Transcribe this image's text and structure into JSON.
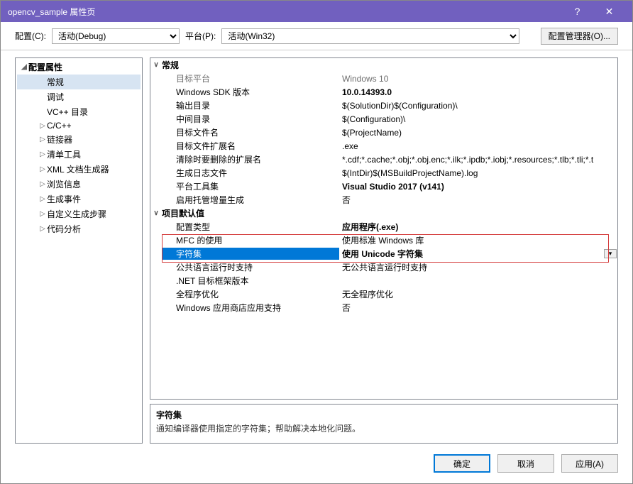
{
  "window": {
    "title": "opencv_sample 属性页"
  },
  "toolbar": {
    "config_label": "配置(C):",
    "config_value": "活动(Debug)",
    "platform_label": "平台(P):",
    "platform_value": "活动(Win32)",
    "manager_button": "配置管理器(O)..."
  },
  "tree": {
    "root": "配置属性",
    "items": [
      {
        "label": "常规",
        "selected": true,
        "expandable": false
      },
      {
        "label": "调试",
        "expandable": false
      },
      {
        "label": "VC++ 目录",
        "expandable": false
      },
      {
        "label": "C/C++",
        "expandable": true
      },
      {
        "label": "链接器",
        "expandable": true
      },
      {
        "label": "清单工具",
        "expandable": true
      },
      {
        "label": "XML 文档生成器",
        "expandable": true
      },
      {
        "label": "浏览信息",
        "expandable": true
      },
      {
        "label": "生成事件",
        "expandable": true
      },
      {
        "label": "自定义生成步骤",
        "expandable": true
      },
      {
        "label": "代码分析",
        "expandable": true
      }
    ]
  },
  "props": {
    "groups": [
      {
        "label": "常规",
        "rows": [
          {
            "name": "目标平台",
            "value": "Windows 10",
            "dim": true
          },
          {
            "name": "Windows SDK 版本",
            "value": "10.0.14393.0",
            "bold": true
          },
          {
            "name": "输出目录",
            "value": "$(SolutionDir)$(Configuration)\\"
          },
          {
            "name": "中间目录",
            "value": "$(Configuration)\\"
          },
          {
            "name": "目标文件名",
            "value": "$(ProjectName)"
          },
          {
            "name": "目标文件扩展名",
            "value": ".exe"
          },
          {
            "name": "清除时要删除的扩展名",
            "value": "*.cdf;*.cache;*.obj;*.obj.enc;*.ilk;*.ipdb;*.iobj;*.resources;*.tlb;*.tli;*.t"
          },
          {
            "name": "生成日志文件",
            "value": "$(IntDir)$(MSBuildProjectName).log"
          },
          {
            "name": "平台工具集",
            "value": "Visual Studio 2017 (v141)",
            "bold": true
          },
          {
            "name": "启用托管增量生成",
            "value": "否"
          }
        ]
      },
      {
        "label": "项目默认值",
        "rows": [
          {
            "name": "配置类型",
            "value": "应用程序(.exe)",
            "bold": true
          },
          {
            "name": "MFC 的使用",
            "value": "使用标准 Windows 库"
          },
          {
            "name": "字符集",
            "value": "使用 Unicode 字符集",
            "selected": true,
            "dropdown": true
          },
          {
            "name": "公共语言运行时支持",
            "value": "无公共语言运行时支持"
          },
          {
            "name": ".NET 目标框架版本",
            "value": ""
          },
          {
            "name": "全程序优化",
            "value": "无全程序优化"
          },
          {
            "name": "Windows 应用商店应用支持",
            "value": "否"
          }
        ]
      }
    ]
  },
  "description": {
    "title": "字符集",
    "text": "通知编译器使用指定的字符集；帮助解决本地化问题。"
  },
  "footer": {
    "ok": "确定",
    "cancel": "取消",
    "apply": "应用(A)"
  }
}
